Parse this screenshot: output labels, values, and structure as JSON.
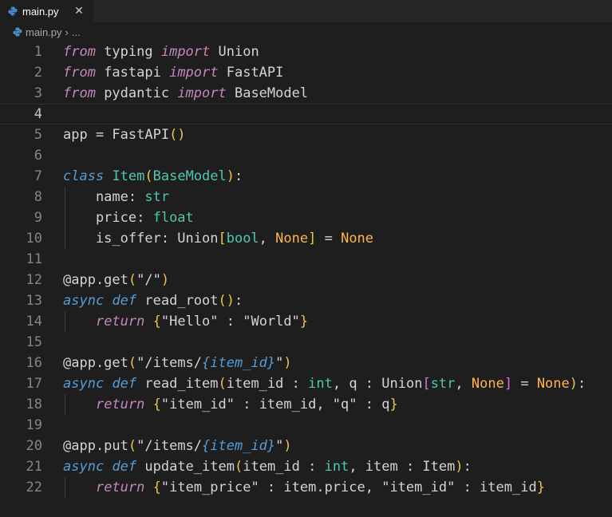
{
  "tab": {
    "filename": "main.py",
    "close_glyph": "✕"
  },
  "breadcrumb": {
    "file": "main.py",
    "separator": "›",
    "rest": "..."
  },
  "colors": {
    "keyword": "#c586c0",
    "type": "#4ec9b0",
    "function": "#dcdcaa",
    "string": "#ce9178",
    "bracket": "#f0c24b",
    "constant": "#ffb450"
  },
  "lines": [
    [
      [
        "kw",
        "from"
      ],
      [
        "df",
        " typing "
      ],
      [
        "kw",
        "import"
      ],
      [
        "df",
        " Union"
      ]
    ],
    [
      [
        "kw",
        "from"
      ],
      [
        "df",
        " fastapi "
      ],
      [
        "kw",
        "import"
      ],
      [
        "df",
        " FastAPI"
      ]
    ],
    [
      [
        "kw",
        "from"
      ],
      [
        "df",
        " pydantic "
      ],
      [
        "kw",
        "import"
      ],
      [
        "df",
        " BaseModel"
      ]
    ],
    [],
    [
      [
        "df",
        "app = FastAPI"
      ],
      [
        "bo",
        "()"
      ]
    ],
    [],
    [
      [
        "kw2",
        "class"
      ],
      [
        "df",
        " "
      ],
      [
        "ty",
        "Item"
      ],
      [
        "bo",
        "("
      ],
      [
        "ty",
        "BaseModel"
      ],
      [
        "bo",
        ")"
      ],
      [
        "df",
        ":"
      ]
    ],
    [
      [
        "df",
        "    name: "
      ],
      [
        "ty",
        "str"
      ]
    ],
    [
      [
        "df",
        "    price: "
      ],
      [
        "ty",
        "float"
      ]
    ],
    [
      [
        "df",
        "    is_offer: Union"
      ],
      [
        "bo",
        "["
      ],
      [
        "ty",
        "bool"
      ],
      [
        "df",
        ", "
      ],
      [
        "cst",
        "None"
      ],
      [
        "bo",
        "]"
      ],
      [
        "df",
        " = "
      ],
      [
        "cst",
        "None"
      ]
    ],
    [],
    [
      [
        "df",
        "@app.get"
      ],
      [
        "bo",
        "("
      ],
      [
        "df",
        "\"/\""
      ],
      [
        "bo",
        ")"
      ]
    ],
    [
      [
        "kw2",
        "async"
      ],
      [
        "df",
        " "
      ],
      [
        "kw2",
        "def"
      ],
      [
        "df",
        " read_root"
      ],
      [
        "bo",
        "()"
      ],
      [
        "df",
        ":"
      ]
    ],
    [
      [
        "df",
        "    "
      ],
      [
        "kw",
        "return"
      ],
      [
        "df",
        " "
      ],
      [
        "bo",
        "{"
      ],
      [
        "df",
        "\"Hello\" : \"World\""
      ],
      [
        "bo",
        "}"
      ]
    ],
    [],
    [
      [
        "df",
        "@app.get"
      ],
      [
        "bo",
        "("
      ],
      [
        "df",
        "\"/items/"
      ],
      [
        "kw2",
        "{item_id}"
      ],
      [
        "df",
        "\""
      ],
      [
        "bo",
        ")"
      ]
    ],
    [
      [
        "kw2",
        "async"
      ],
      [
        "df",
        " "
      ],
      [
        "kw2",
        "def"
      ],
      [
        "df",
        " read_item"
      ],
      [
        "bo",
        "("
      ],
      [
        "df",
        "item_id : "
      ],
      [
        "ty",
        "int"
      ],
      [
        "df",
        ", q : Union"
      ],
      [
        "pb",
        "["
      ],
      [
        "ty",
        "str"
      ],
      [
        "df",
        ", "
      ],
      [
        "cst",
        "None"
      ],
      [
        "pb",
        "]"
      ],
      [
        "df",
        " = "
      ],
      [
        "cst",
        "None"
      ],
      [
        "bo",
        ")"
      ],
      [
        "df",
        ":"
      ]
    ],
    [
      [
        "df",
        "    "
      ],
      [
        "kw",
        "return"
      ],
      [
        "df",
        " "
      ],
      [
        "bo",
        "{"
      ],
      [
        "df",
        "\"item_id\" : item_id, \"q\" : q"
      ],
      [
        "bo",
        "}"
      ]
    ],
    [],
    [
      [
        "df",
        "@app.put"
      ],
      [
        "bo",
        "("
      ],
      [
        "df",
        "\"/items/"
      ],
      [
        "kw2",
        "{item_id}"
      ],
      [
        "df",
        "\""
      ],
      [
        "bo",
        ")"
      ]
    ],
    [
      [
        "kw2",
        "async"
      ],
      [
        "df",
        " "
      ],
      [
        "kw2",
        "def"
      ],
      [
        "df",
        " update_item"
      ],
      [
        "bo",
        "("
      ],
      [
        "df",
        "item_id : "
      ],
      [
        "ty",
        "int"
      ],
      [
        "df",
        ", item : Item"
      ],
      [
        "bo",
        ")"
      ],
      [
        "df",
        ":"
      ]
    ],
    [
      [
        "df",
        "    "
      ],
      [
        "kw",
        "return"
      ],
      [
        "df",
        " "
      ],
      [
        "bo",
        "{"
      ],
      [
        "df",
        "\"item_price\" : item.price, \"item_id\" : item_id"
      ],
      [
        "bo",
        "}"
      ]
    ]
  ],
  "line_numbers": [
    "1",
    "2",
    "3",
    "4",
    "5",
    "6",
    "7",
    "8",
    "9",
    "10",
    "11",
    "12",
    "13",
    "14",
    "15",
    "16",
    "17",
    "18",
    "19",
    "20",
    "21",
    "22"
  ],
  "active_line": 4
}
